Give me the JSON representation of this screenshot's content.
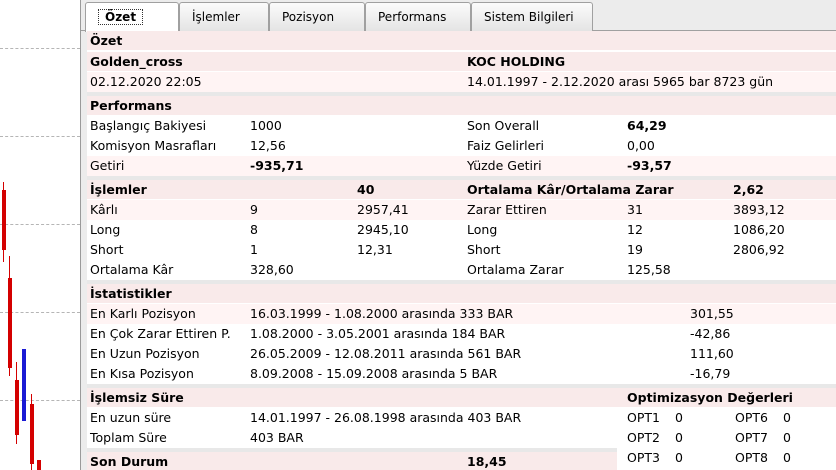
{
  "tabs": [
    {
      "label": "Özet",
      "active": true
    },
    {
      "label": "İşlemler",
      "active": false
    },
    {
      "label": "Pozisyon",
      "active": false
    },
    {
      "label": "Performans",
      "active": false
    },
    {
      "label": "Sistem Bilgileri",
      "active": false
    }
  ],
  "ozet": {
    "title": "Özet",
    "system_name": "Golden_cross",
    "symbol": "KOC HOLDING",
    "report_date": "02.12.2020 22:05",
    "period": "14.01.1997 - 2.12.2020 arası 5965 bar 8723 gün"
  },
  "performans": {
    "title": "Performans",
    "baslangic_label": "Başlangıç Bakiyesi",
    "baslangic_value": "1000",
    "son_overall_label": "Son Overall",
    "son_overall_value": "64,29",
    "komisyon_label": "Komisyon Masrafları",
    "komisyon_value": "12,56",
    "faiz_label": "Faiz Gelirleri",
    "faiz_value": "0,00",
    "getiri_label": "Getiri",
    "getiri_value": "-935,71",
    "yuzde_label": "Yüzde Getiri",
    "yuzde_value": "-93,57"
  },
  "islemler": {
    "title": "İşlemler",
    "count": "40",
    "ort_title": "Ortalama Kâr/Ortalama Zarar",
    "ort_value": "2,62",
    "rows": [
      {
        "l1": "Kârlı",
        "v1": "9",
        "a1": "2957,41",
        "l2": "Zarar Ettiren",
        "v2": "31",
        "a2": "3893,12"
      },
      {
        "l1": "Long",
        "v1": "8",
        "a1": "2945,10",
        "l2": "Long",
        "v2": "12",
        "a2": "1086,20"
      },
      {
        "l1": "Short",
        "v1": "1",
        "a1": "12,31",
        "l2": "Short",
        "v2": "19",
        "a2": "2806,92"
      },
      {
        "l1": "Ortalama Kâr",
        "v1": "328,60",
        "a1": "",
        "l2": "Ortalama Zarar",
        "v2": "125,58",
        "a2": ""
      }
    ]
  },
  "istatistikler": {
    "title": "İstatistikler",
    "rows": [
      {
        "label": "En Karlı Pozisyon",
        "range": "16.03.1999 - 1.08.2000 arasında 333 BAR",
        "value": "301,55"
      },
      {
        "label": "En Çok Zarar Ettiren P.",
        "range": "1.08.2000 - 3.05.2001 arasında 184 BAR",
        "value": "-42,86"
      },
      {
        "label": "En Uzun Pozisyon",
        "range": "26.05.2009 - 12.08.2011 arasında 561 BAR",
        "value": "111,60"
      },
      {
        "label": "En Kısa Pozisyon",
        "range": "8.09.2008 - 15.09.2008 arasında 5 BAR",
        "value": "-16,79"
      }
    ]
  },
  "islemsiz": {
    "title": "İşlemsiz Süre",
    "en_uzun_label": "En uzun süre",
    "en_uzun_value": "14.01.1997 - 26.08.1998 arasında 403 BAR",
    "toplam_label": "Toplam Süre",
    "toplam_value": "403 BAR"
  },
  "optimizasyon": {
    "title": "Optimizasyon Değerleri",
    "items": [
      {
        "name": "OPT1",
        "value": "0"
      },
      {
        "name": "OPT6",
        "value": "0"
      },
      {
        "name": "OPT2",
        "value": "0"
      },
      {
        "name": "OPT7",
        "value": "0"
      },
      {
        "name": "OPT3",
        "value": "0"
      },
      {
        "name": "OPT8",
        "value": "0"
      }
    ]
  },
  "son_durum": {
    "label": "Son Durum",
    "value": "18,45"
  },
  "colors": {
    "section_bg": "#f9eaea",
    "alt_row_bg": "#fff4f4",
    "candle_red": "#d40000",
    "candle_blue": "#1a1ad4"
  }
}
